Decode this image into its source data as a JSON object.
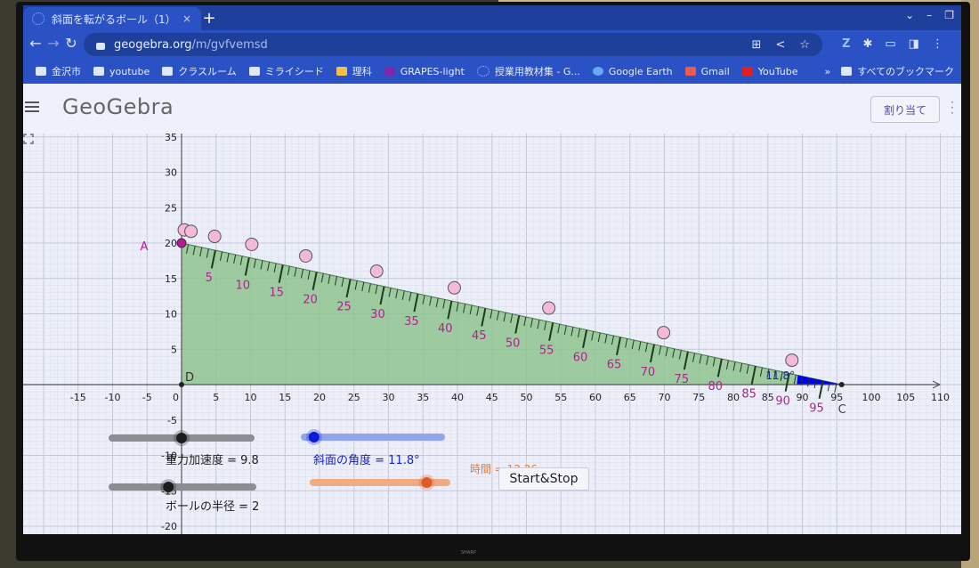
{
  "browser": {
    "tab_title": "斜面を転がるボール（1）",
    "tab_close": "×",
    "new_tab": "+",
    "url_host": "geogebra.org",
    "url_path": "/m/gvfvemsd",
    "bookmarks": [
      {
        "label": "金沢市",
        "icon": "folder-icon"
      },
      {
        "label": "youtube",
        "icon": "folder-icon"
      },
      {
        "label": "クラスルーム",
        "icon": "folder-icon"
      },
      {
        "label": "ミライシード",
        "icon": "miraiseed-icon"
      },
      {
        "label": "理科",
        "icon": "google-drive-icon"
      },
      {
        "label": "GRAPES-light",
        "icon": "grapes-icon"
      },
      {
        "label": "授業用教材集 - G...",
        "icon": "loading-icon"
      },
      {
        "label": "Google Earth",
        "icon": "google-earth-icon"
      },
      {
        "label": "Gmail",
        "icon": "gmail-icon"
      },
      {
        "label": "YouTube",
        "icon": "youtube-icon"
      }
    ],
    "all_bookmarks": "すべてのブックマーク",
    "more_bookmarks": "»"
  },
  "geogebra": {
    "logo": "GeoGebra",
    "assign_button": "割り当て",
    "start_stop": "Start&Stop",
    "gravity_label": "重力加速度 = 9.8",
    "gravity_value": 9.8,
    "angle_label": "斜面の角度 = 11.8°",
    "angle_value": 11.8,
    "time_label": "時間 = 12.26",
    "time_value": 12.26,
    "radius_label": "ボールの半径 = 2",
    "radius_value": 2,
    "angle_marker": "11.8°",
    "point_labels": {
      "A": "A",
      "C": "C",
      "D": "D"
    },
    "x_ticks": [
      -15,
      -10,
      -5,
      0,
      5,
      10,
      15,
      20,
      25,
      30,
      35,
      40,
      45,
      50,
      55,
      60,
      65,
      70,
      75,
      80,
      85,
      90,
      95,
      100,
      105,
      110
    ],
    "y_ticks": [
      35,
      30,
      25,
      20,
      15,
      10,
      5,
      -5,
      -10,
      -15,
      -20
    ],
    "ramp_ticks": [
      5,
      10,
      15,
      20,
      25,
      30,
      35,
      40,
      45,
      50,
      55,
      60,
      65,
      70,
      75,
      80,
      85,
      90,
      95
    ],
    "ramp_top_y": 20,
    "ramp_end_x": 95.7,
    "ball_positions_along_ramp": [
      0,
      1,
      4.5,
      10,
      18,
      28.5,
      40,
      54,
      71,
      90
    ],
    "colors": {
      "ramp_fill": "#8fc48f",
      "ramp_label": "#b0228f",
      "angle_fill": "#0000ee",
      "angle_label": "#1a22c8",
      "ball_fill": "#f2b9d8",
      "point_A": "#c0149a",
      "time_color": "#e07a3c",
      "angle_slider": "#8fa6ee",
      "time_slider": "#f0ab83"
    }
  }
}
